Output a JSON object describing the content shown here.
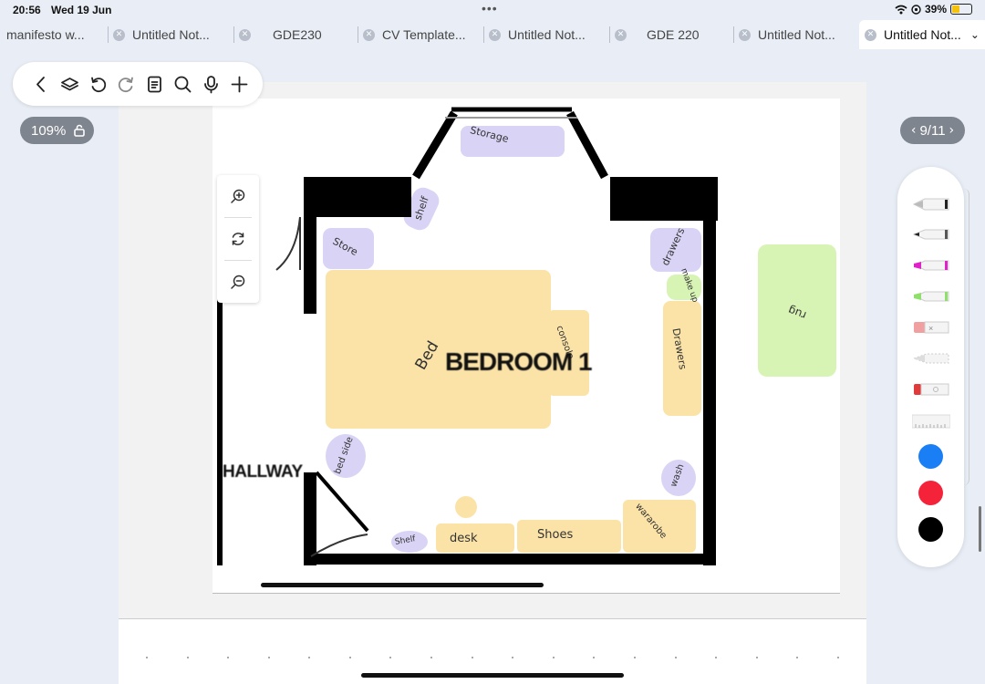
{
  "status_bar": {
    "time": "20:56",
    "date": "Wed 19 Jun",
    "battery_percent": "39%",
    "battery_level": 0.39,
    "battery_color": "#f4c20d"
  },
  "tabs": [
    {
      "label": "manifesto w..."
    },
    {
      "label": "Untitled Not..."
    },
    {
      "label": "GDE230"
    },
    {
      "label": "CV Template..."
    },
    {
      "label": "Untitled Not..."
    },
    {
      "label": "GDE 220"
    },
    {
      "label": "Untitled Not..."
    },
    {
      "label": "Untitled Not..."
    }
  ],
  "toolbar": {
    "icons": [
      "back-icon",
      "layers-icon",
      "undo-icon",
      "redo-icon",
      "document-icon",
      "search-icon",
      "microphone-icon",
      "plus-icon"
    ]
  },
  "zoom": {
    "level": "109%"
  },
  "page_nav": {
    "label": "9/11",
    "prev": "‹",
    "next": "›"
  },
  "floor_plan": {
    "room_title": "BEDROOM 1",
    "hallway_title": "HALLWAY",
    "labels": {
      "storage": "Storage",
      "shelf_top": "shelf",
      "store": "Store",
      "drawers_top": "drawers",
      "make_up": "make up",
      "bed": "Bed",
      "console": "console",
      "drawers_right": "Drawers",
      "rug": "rug",
      "bed_side": "bed side",
      "wash": "wash",
      "wardrobe": "wararobe",
      "shelf_bottom": "Shelf",
      "desk": "desk",
      "shoes": "Shoes"
    },
    "colors": {
      "yellow": "#fbe3a8",
      "purple": "#d9d3f5",
      "green": "#d7f4b4",
      "wall": "#000000"
    }
  },
  "pen_panel": {
    "tools": [
      "fountain-pen-icon",
      "pencil-icon",
      "magenta-highlighter-icon",
      "green-highlighter-icon",
      "eraser-icon",
      "lasso-icon",
      "red-marker-icon",
      "ruler-icon"
    ],
    "colors": [
      "#1a7ef5",
      "#f5233a",
      "#000000"
    ]
  }
}
